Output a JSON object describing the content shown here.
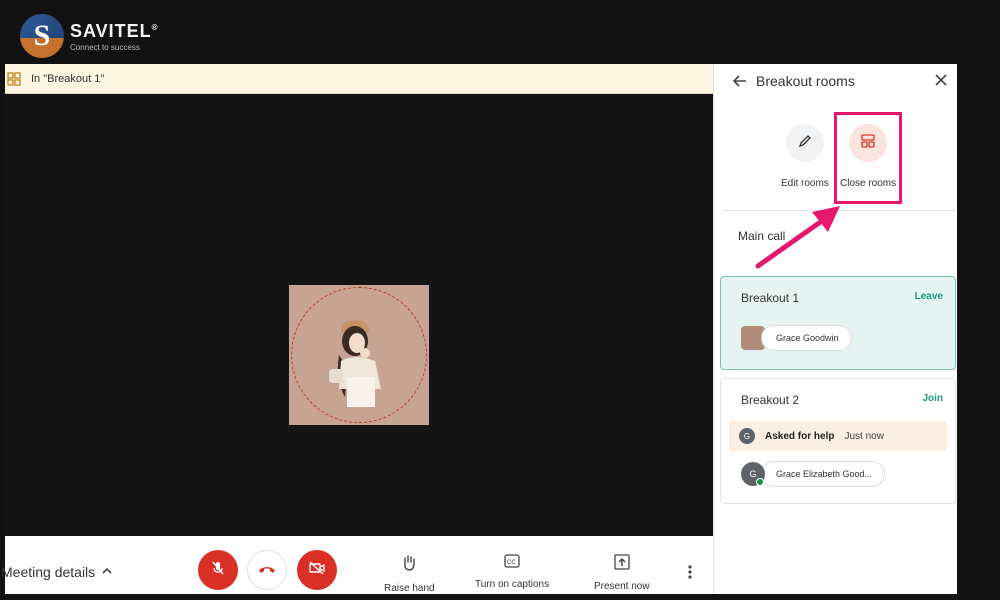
{
  "logo": {
    "name": "SAVITEL",
    "registered": "®",
    "tagline": "Connect to success",
    "mark": "S"
  },
  "banner": {
    "text": "In \"Breakout 1\""
  },
  "bottom_bar": {
    "meeting_details_label": "Meeting details",
    "tools": [
      {
        "label": "Raise hand"
      },
      {
        "label": "Turn on captions"
      },
      {
        "label": "Present now"
      }
    ]
  },
  "panel": {
    "title": "Breakout rooms",
    "actions": [
      {
        "label": "Edit rooms"
      },
      {
        "label": "Close rooms"
      }
    ],
    "main_call_label": "Main call",
    "rooms": [
      {
        "name": "Breakout 1",
        "action": "Leave",
        "participants": [
          {
            "name": "Grace Goodwin"
          }
        ]
      },
      {
        "name": "Breakout 2",
        "action": "Join",
        "help": {
          "initial": "G",
          "text": "Asked for help",
          "time": "Just now"
        },
        "participants": [
          {
            "initial": "G",
            "name": "Grace Elizabeth Good..."
          }
        ]
      }
    ]
  },
  "colors": {
    "accent_red": "#d93025",
    "highlight_pink": "#e6186d",
    "teal": "#1a9a7d",
    "banner_bg": "#fdf6e3"
  }
}
